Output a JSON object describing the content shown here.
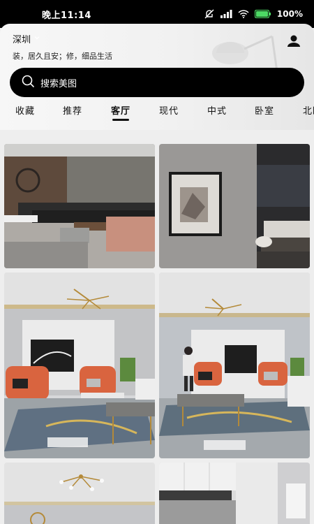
{
  "status_bar": {
    "time": "晚上11:14",
    "battery": "100%"
  },
  "header": {
    "city": "深圳",
    "slogan": "装，居久且安；修，细品生活"
  },
  "search": {
    "placeholder": "搜索美图"
  },
  "tabs": [
    {
      "label": "收藏",
      "active": false
    },
    {
      "label": "推荐",
      "active": false
    },
    {
      "label": "客厅",
      "active": true
    },
    {
      "label": "现代",
      "active": false
    },
    {
      "label": "中式",
      "active": false
    },
    {
      "label": "卧室",
      "active": false
    },
    {
      "label": "北欧",
      "active": false
    }
  ],
  "gallery": [
    {
      "scene": "dark-sofa-living-room"
    },
    {
      "scene": "framed-art-bedroom"
    },
    {
      "scene": "orange-chairs-living-room"
    },
    {
      "scene": "orange-chairs-living-room-person"
    },
    {
      "scene": "chandelier-ceiling"
    },
    {
      "scene": "kitchen-cabinets"
    }
  ],
  "colors": {
    "accent": "#000000",
    "chair": "#d9643f",
    "background": "#eeeeee"
  }
}
